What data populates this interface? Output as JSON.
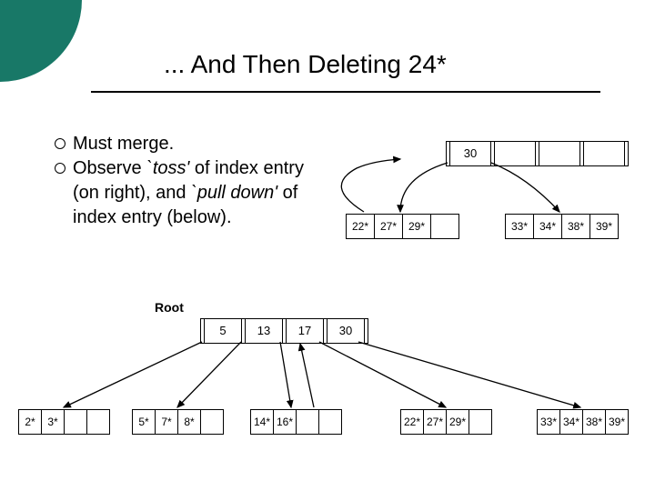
{
  "title": "... And Then Deleting 24*",
  "bullets": [
    {
      "plain": "Must merge."
    },
    {
      "html": "Observe <em>`toss'</em> of index entry (on right), and <em>`pull down'</em> of index entry (below)."
    }
  ],
  "top_figure": {
    "index": {
      "key": "30"
    },
    "leaf_left": [
      "22*",
      "27*",
      "29*",
      ""
    ],
    "leaf_right": [
      "33*",
      "34*",
      "38*",
      "39*"
    ]
  },
  "bottom_figure": {
    "root_label": "Root",
    "root_keys": [
      "5",
      "13",
      "17",
      "30"
    ],
    "leaves": [
      [
        "2*",
        "3*",
        "",
        ""
      ],
      [
        "5*",
        "7*",
        "8*",
        ""
      ],
      [
        "14*",
        "16*",
        "",
        ""
      ],
      [
        "22*",
        "27*",
        "29*",
        ""
      ],
      [
        "33*",
        "34*",
        "38*",
        "39*"
      ]
    ]
  }
}
